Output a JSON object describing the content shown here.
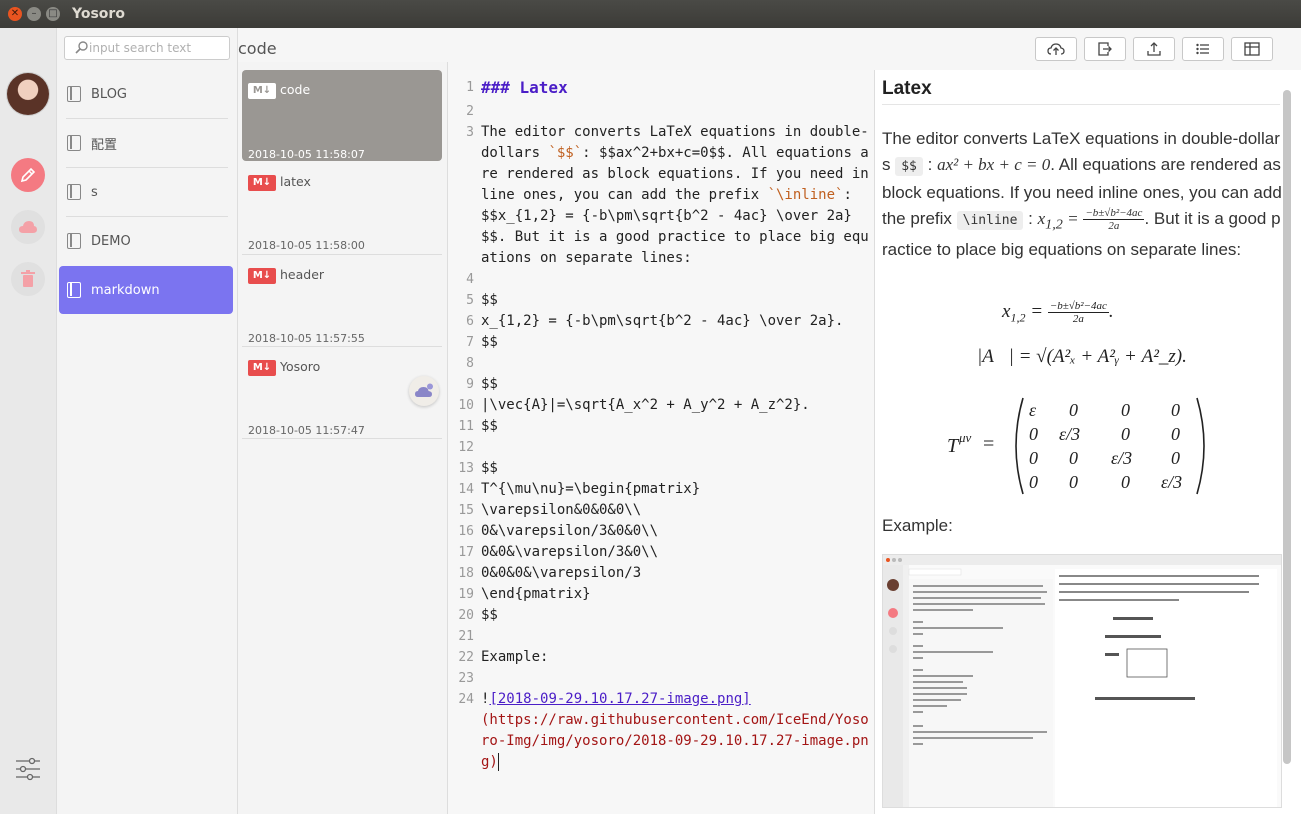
{
  "window": {
    "title": "Yosoro"
  },
  "search": {
    "placeholder": "input search text"
  },
  "breadcrumb": "code",
  "folders": [
    {
      "label": "BLOG"
    },
    {
      "label": "配置"
    },
    {
      "label": "s"
    },
    {
      "label": "DEMO"
    },
    {
      "label": "markdown",
      "active": true
    }
  ],
  "notes": [
    {
      "title": "code",
      "date": "2018-10-05 11:58:07",
      "badge": "M↓"
    },
    {
      "title": "latex",
      "date": "2018-10-05 11:58:00",
      "badge": "M↓"
    },
    {
      "title": "header",
      "date": "2018-10-05 11:57:55",
      "badge": "M↓"
    },
    {
      "title": "Yosoro",
      "date": "2018-10-05 11:57:47",
      "badge": "M↓"
    }
  ],
  "toolbar": [
    "cloud-upload-icon",
    "export-icon",
    "share-icon",
    "list-icon",
    "layout-icon"
  ],
  "editor": {
    "lines": [
      {
        "n": "1",
        "text": "### Latex"
      },
      {
        "n": "2",
        "text": ""
      },
      {
        "n": "3",
        "a": "The editor converts LaTeX equations in double-dollars ",
        "b": "`$$`",
        "c": ": $$ax^2+bx+c=0$$. All equations are rendered as block equations. If you need inline ones, you can add the prefix ",
        "d": "`\\inline`",
        "e": ": $$x_{1,2} = {-b\\pm\\sqrt{b^2 - 4ac} \\over 2a}$$. But it is a good practice to place big equations on separate lines:"
      },
      {
        "n": "4",
        "text": ""
      },
      {
        "n": "5",
        "text": "$$"
      },
      {
        "n": "6",
        "text": "x_{1,2} = {-b\\pm\\sqrt{b^2 - 4ac} \\over 2a}."
      },
      {
        "n": "7",
        "text": "$$"
      },
      {
        "n": "8",
        "text": ""
      },
      {
        "n": "9",
        "text": "$$"
      },
      {
        "n": "10",
        "text": "|\\vec{A}|=\\sqrt{A_x^2 + A_y^2 + A_z^2}."
      },
      {
        "n": "11",
        "text": "$$"
      },
      {
        "n": "12",
        "text": ""
      },
      {
        "n": "13",
        "text": "$$"
      },
      {
        "n": "14",
        "text": "T^{\\mu\\nu}=\\begin{pmatrix}"
      },
      {
        "n": "15",
        "text": "\\varepsilon&0&0&0\\\\"
      },
      {
        "n": "16",
        "text": "0&\\varepsilon/3&0&0\\\\"
      },
      {
        "n": "17",
        "text": "0&0&\\varepsilon/3&0\\\\"
      },
      {
        "n": "18",
        "text": "0&0&0&\\varepsilon/3"
      },
      {
        "n": "19",
        "text": "\\end{pmatrix}"
      },
      {
        "n": "20",
        "text": "$$"
      },
      {
        "n": "21",
        "text": ""
      },
      {
        "n": "22",
        "text": "Example:"
      },
      {
        "n": "23",
        "text": ""
      },
      {
        "n": "24",
        "bang": "!",
        "link": "[2018-09-29.10.17.27-image.png]",
        "url": "(https://raw.githubusercontent.com/IceEnd/Yosoro-Img/img/yosoro/2018-09-29.10.17.27-image.png)"
      }
    ]
  },
  "preview": {
    "heading": "Latex",
    "p1": "The editor converts LaTeX equations in double-dollars ",
    "code1": "$$",
    "p2": ". All equations are rendered as block equations. If you need inline ones, you can add the prefix ",
    "code2": "\\inline",
    "p3": ". But it is a good practice to place big equations on separate lines:",
    "eq_inline1": "ax² + bx + c = 0",
    "eq_inline2_lhs": "x",
    "eq1": "x₁,₂ = ",
    "eq2": "|A⃗| = √(A²ₓ + A²ᵧ + A²_z).",
    "example": "Example:"
  },
  "colors": {
    "accent": "#7b74f0",
    "edit_button": "#f47a82",
    "badge": "#e84d4d"
  }
}
